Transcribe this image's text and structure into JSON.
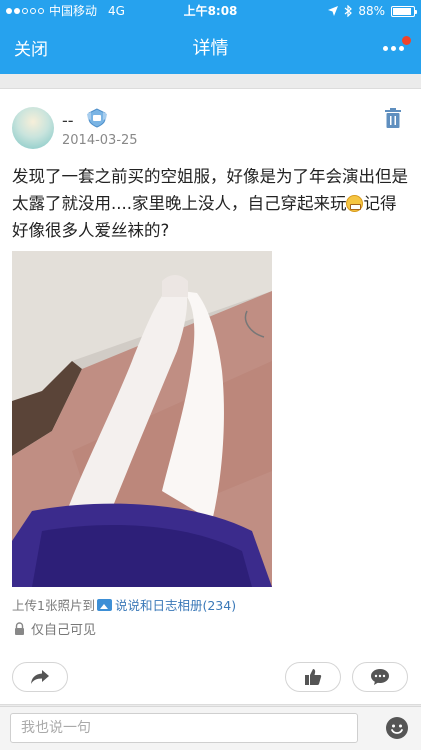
{
  "status_bar": {
    "carrier": "中国移动",
    "network": "4G",
    "time": "上午8:08",
    "battery": "88%",
    "battery_level": 0.88,
    "signal_bars": 5,
    "signal_filled": 2
  },
  "nav": {
    "close_label": "关闭",
    "title": "详情",
    "more_icon": "more-dots-icon",
    "accent_color": "#26a2ee",
    "badge_color": "#f0442b"
  },
  "post": {
    "username": "--",
    "date": "2014-03-25",
    "text_part1": "发现了一套之前买的空姐服，好像是为了年会演出但是太露了就没用....家里晚上没人，自己穿起来玩",
    "text_part2": "记得好像很多人爱丝袜的?",
    "upload_prefix": "上传1张照片到",
    "album_name": "说说和日志相册(234)",
    "privacy": "仅自己可见"
  },
  "comment": {
    "placeholder": "我也说一句"
  }
}
